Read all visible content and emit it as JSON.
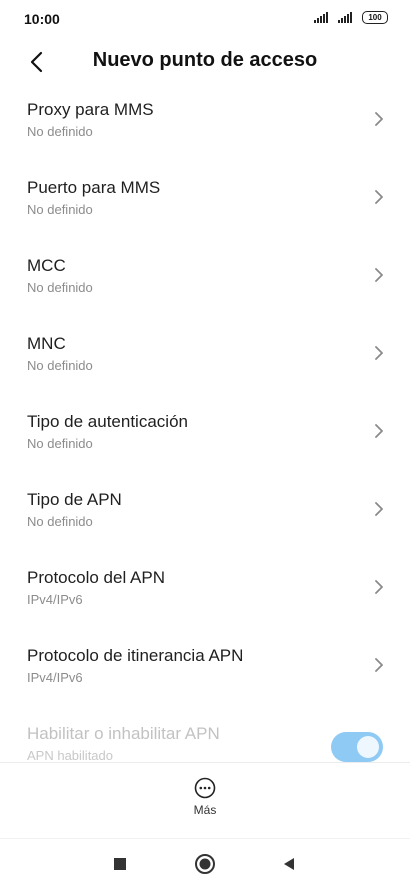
{
  "status_bar": {
    "time": "10:00",
    "battery": "100"
  },
  "header": {
    "title": "Nuevo punto de acceso",
    "back_icon": "chevron-left-icon"
  },
  "items": [
    {
      "title": "Proxy para MMS",
      "value": "No definido"
    },
    {
      "title": "Puerto para MMS",
      "value": "No definido"
    },
    {
      "title": "MCC",
      "value": "No definido"
    },
    {
      "title": "MNC",
      "value": "No definido"
    },
    {
      "title": "Tipo de autenticación",
      "value": "No definido"
    },
    {
      "title": "Tipo de APN",
      "value": "No definido"
    },
    {
      "title": "Protocolo del APN",
      "value": "IPv4/IPv6"
    },
    {
      "title": "Protocolo de itinerancia APN",
      "value": "IPv4/IPv6"
    }
  ],
  "toggle_item": {
    "title": "Habilitar o inhabilitar APN",
    "value": "APN habilitado",
    "enabled": true,
    "accent": "#8fcaf5"
  },
  "action_bar": {
    "more_label": "Más",
    "more_icon": "more-dots-icon"
  },
  "nav_bar": {
    "icons": [
      "square-recents-icon",
      "circle-home-icon",
      "triangle-back-icon"
    ]
  }
}
